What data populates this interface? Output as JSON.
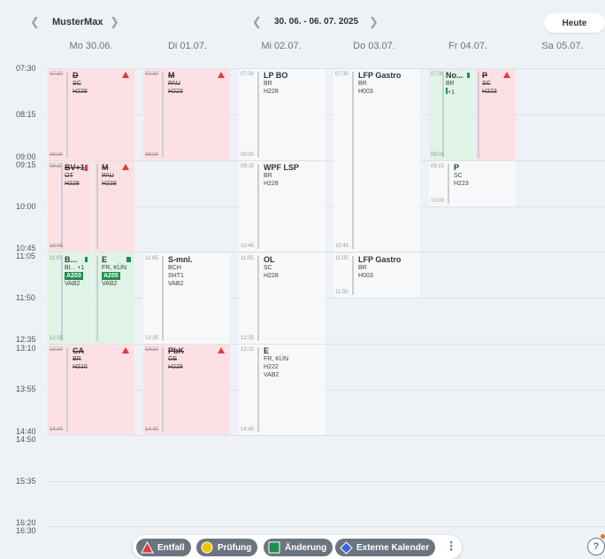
{
  "header": {
    "prev_class_icon": "chevron-left",
    "class_name": "MusterMax",
    "next_class_icon": "chevron-right",
    "prev_week_icon": "chevron-left",
    "week_range": "30. 06. - 06. 07. 2025",
    "next_week_icon": "chevron-right",
    "today_label": "Heute"
  },
  "days": [
    "Mo 30.06.",
    "Di 01.07.",
    "Mi 02.07.",
    "Do 03.07.",
    "Fr 04.07.",
    "Sa 05.07."
  ],
  "time_labels": [
    "07:30",
    "08:15",
    "09:00",
    "09:15",
    "10:00",
    "10:45",
    "11:05",
    "11:50",
    "12:35",
    "13:10",
    "13:55",
    "14:40",
    "14:50",
    "15:35",
    "16:20",
    "16:30"
  ],
  "lessons": {
    "mo1": {
      "start": "07:30",
      "end": "09:00",
      "subject": "D",
      "teacher": "SC",
      "room": "H228"
    },
    "mo2a": {
      "start": "09:15",
      "end": "10:45",
      "subject": "BV+1",
      "teacher": "OT",
      "room": "H228"
    },
    "mo2b": {
      "subject": "M",
      "teacher": "PAU",
      "room": "H228"
    },
    "mo3a": {
      "start": "11:05",
      "end": "12:35",
      "subject": "B...",
      "teacher": "BI...",
      "extra": "+1",
      "room": "A203",
      "class": "VAB2"
    },
    "mo3b": {
      "subject": "E",
      "teacher": "FR, KÜN",
      "room": "A205",
      "class": "VAB2"
    },
    "mo4": {
      "start": "13:10",
      "end": "14:40",
      "subject": "CA",
      "teacher": "BR",
      "room": "H210"
    },
    "di1": {
      "start": "07:30",
      "end": "09:00",
      "subject": "M",
      "teacher": "PAU",
      "room": "H223"
    },
    "di3": {
      "start": "11:05",
      "end": "12:35",
      "subject": "S-mnl.",
      "teacher": "BCH",
      "room": "SHT1",
      "class": "VAB2"
    },
    "di4": {
      "start": "13:10",
      "end": "14:40",
      "subject": "PbK",
      "teacher": "GE",
      "room": "H228"
    },
    "mi1": {
      "start": "07:30",
      "end": "09:00",
      "subject": "LP BO",
      "teacher": "BR",
      "room": "H228"
    },
    "mi2": {
      "start": "09:15",
      "end": "10:45",
      "subject": "WPF LSP",
      "teacher": "BR",
      "room": "H228"
    },
    "mi3": {
      "start": "11:05",
      "end": "12:35",
      "subject": "OL",
      "teacher": "SC",
      "room": "H228"
    },
    "mi4": {
      "start": "13:10",
      "end": "14:40",
      "subject": "E",
      "teacher": "FR, KÜN",
      "room": "H222",
      "class": "VAB2"
    },
    "do1": {
      "start": "07:30",
      "end": "10:45",
      "subject": "LFP Gastro",
      "teacher": "BR",
      "room": "H003"
    },
    "do3": {
      "start": "11:05",
      "end": "11:50",
      "subject": "LFP Gastro",
      "teacher": "BR",
      "room": "H003"
    },
    "fr1a": {
      "start": "07:30",
      "end": "09:00",
      "subject": "No...",
      "teacher": "BR",
      "extra": "+1"
    },
    "fr1b": {
      "subject": "P",
      "teacher": "SC",
      "room": "H223"
    },
    "fr2": {
      "start": "09:15",
      "end": "10:00",
      "subject": "P",
      "teacher": "SC",
      "room": "H223"
    }
  },
  "legend": {
    "cancel": "Entfall",
    "exam": "Prüfung",
    "change": "Änderung",
    "external": "Externe Kalender"
  },
  "colors": {
    "cancel": "#fde0e3",
    "change": "#dff3e6",
    "cancel_icon": "#e03a3a",
    "exam_icon": "#f2c200",
    "change_icon": "#1e8e4e",
    "external_icon": "#3a66d8"
  },
  "help_icon": "?"
}
